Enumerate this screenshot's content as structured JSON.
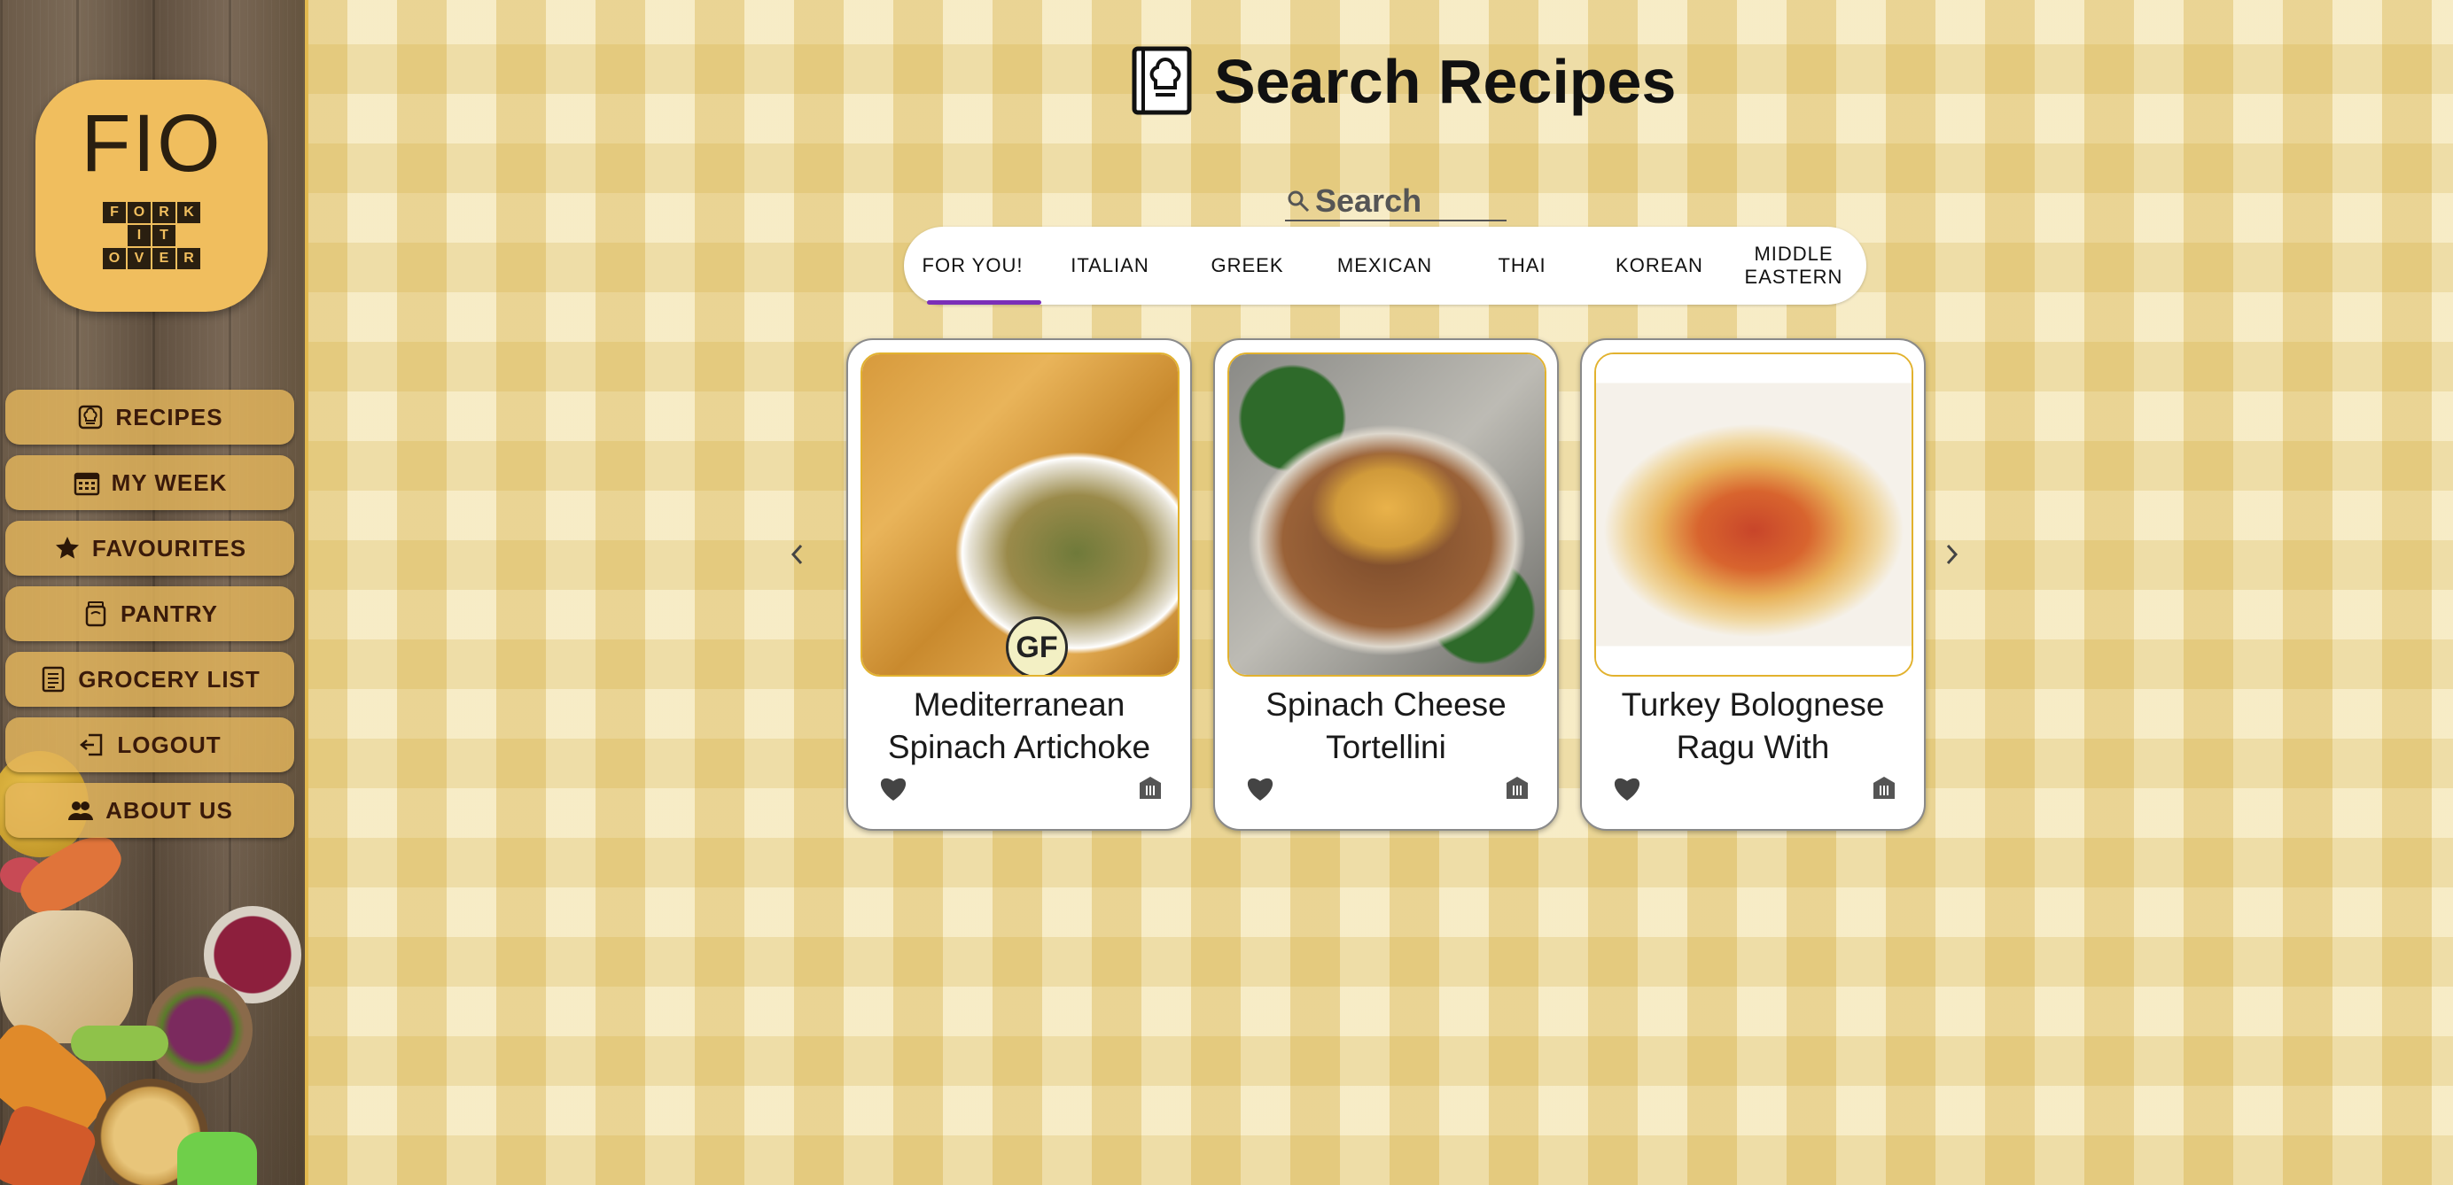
{
  "logo": {
    "text": "FIO",
    "grid": [
      [
        "F",
        "O",
        "R",
        "K"
      ],
      [
        "",
        "I",
        "T",
        ""
      ],
      [
        "O",
        "V",
        "E",
        "R"
      ]
    ]
  },
  "nav": [
    {
      "label": "RECIPES",
      "icon": "chef-hat-icon"
    },
    {
      "label": "MY WEEK",
      "icon": "calendar-icon"
    },
    {
      "label": "FAVOURITES",
      "icon": "star-icon"
    },
    {
      "label": "PANTRY",
      "icon": "pantry-jar-icon"
    },
    {
      "label": "GROCERY LIST",
      "icon": "list-icon"
    },
    {
      "label": "LOGOUT",
      "icon": "logout-icon"
    },
    {
      "label": "ABOUT US",
      "icon": "group-icon"
    }
  ],
  "page": {
    "title": "Search Recipes",
    "title_icon": "chef-book-icon"
  },
  "search": {
    "placeholder": "Search",
    "icon": "search-icon"
  },
  "tabs": [
    {
      "label": "FOR YOU!",
      "active": true
    },
    {
      "label": "ITALIAN",
      "active": false
    },
    {
      "label": "GREEK",
      "active": false
    },
    {
      "label": "MEXICAN",
      "active": false
    },
    {
      "label": "THAI",
      "active": false
    },
    {
      "label": "KOREAN",
      "active": false
    },
    {
      "label": "MIDDLE EASTERN",
      "active": false
    }
  ],
  "carousel": {
    "prev_icon": "chevron-left-icon",
    "next_icon": "chevron-right-icon"
  },
  "recipes": [
    {
      "title": "Mediterranean Spinach Artichoke",
      "badge": "GF",
      "image": "spinach-artichoke-dip-photo"
    },
    {
      "title": "Spinach Cheese Tortellini",
      "badge": "",
      "image": "tortellini-photo"
    },
    {
      "title": "Turkey Bolognese Ragu With",
      "badge": "",
      "image": "bolognese-photo"
    }
  ],
  "colors": {
    "accent_purple": "#7b2fb8",
    "nav_gold": "#e4b65c",
    "logo_gold": "#f0be5e",
    "card_border_gold": "#e2b22e"
  }
}
